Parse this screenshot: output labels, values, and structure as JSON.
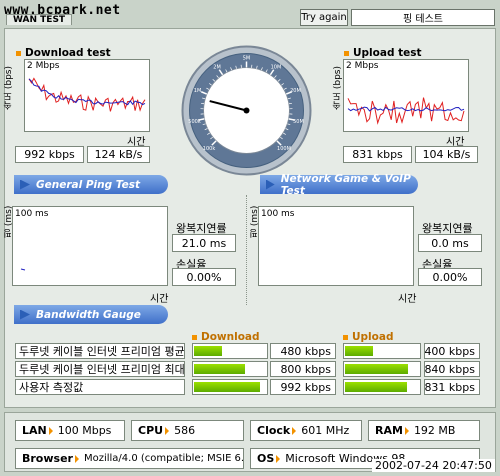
{
  "header": {
    "watermark": "www.bcpark.net",
    "tab_label": "WAN TEST",
    "try_again_label": "Try again",
    "ping_test_label": "핑 테스트"
  },
  "download": {
    "title": "Download test",
    "y_axis_label": "속도 (bps)",
    "y_max_label": "2 Mbps",
    "x_axis_label": "시간",
    "kbps": "992 kbps",
    "kBs": "124 kB/s"
  },
  "upload": {
    "title": "Upload test",
    "y_axis_label": "속도 (bps)",
    "y_max_label": "2 Mbps",
    "x_axis_label": "시간",
    "kbps": "831 kbps",
    "kBs": "104 kB/s"
  },
  "gauge": {
    "labels": [
      "100k",
      "500k",
      "1M",
      "2M",
      "5M",
      "10M",
      "20M",
      "50M",
      "100M"
    ],
    "needle_fraction": 0.22
  },
  "sections": {
    "general_ping": "General Ping Test",
    "network_game": "Network Game & VoIP Test",
    "bandwidth": "Bandwidth Gauge"
  },
  "ping_left": {
    "y_axis_label": "핑 (ms)",
    "y_max_label": "100 ms",
    "x_axis_label": "시간",
    "rtt_label": "왕복지연률",
    "rtt_value": "21.0 ms",
    "loss_label": "손실율",
    "loss_value": "0.00%"
  },
  "ping_right": {
    "y_axis_label": "핑 (ms)",
    "y_max_label": "100 ms",
    "x_axis_label": "시간",
    "rtt_label": "왕복지연률",
    "rtt_value": "0.0 ms",
    "loss_label": "손실율",
    "loss_value": "0.00%"
  },
  "bandwidth": {
    "download_header": "Download",
    "upload_header": "Upload",
    "rows": [
      {
        "label": "두루넷 케이블 인터넷 프리미엄 평균",
        "download": "480 kbps",
        "download_fraction": 0.4,
        "upload": "400 kbps",
        "upload_fraction": 0.4
      },
      {
        "label": "두루넷 케이블 인터넷 프리미엄 최대",
        "download": "800 kbps",
        "download_fraction": 0.72,
        "upload": "840 kbps",
        "upload_fraction": 0.85
      },
      {
        "label": "사용자 측정값",
        "download": "992 kbps",
        "download_fraction": 0.92,
        "upload": "831 kbps",
        "upload_fraction": 0.84
      }
    ]
  },
  "system": {
    "lan_label": "LAN",
    "lan_value": "100 Mbps",
    "cpu_label": "CPU",
    "cpu_value": "586",
    "clock_label": "Clock",
    "clock_value": "601 MHz",
    "ram_label": "RAM",
    "ram_value": "192 MB",
    "browser_label": "Browser",
    "browser_value": "Mozilla/4.0 (compatible; MSIE 6.0",
    "os_label": "OS",
    "os_value": "Microsoft Windows 98",
    "timestamp": "2002-07-24 20:47:50"
  },
  "colors": {
    "background": "#c9d3c9",
    "section_pill": "#3f6fc9",
    "accent_orange": "#f29200",
    "bar_green": "#7ccc00",
    "series_red": "#e02020",
    "series_blue": "#2020c0"
  }
}
